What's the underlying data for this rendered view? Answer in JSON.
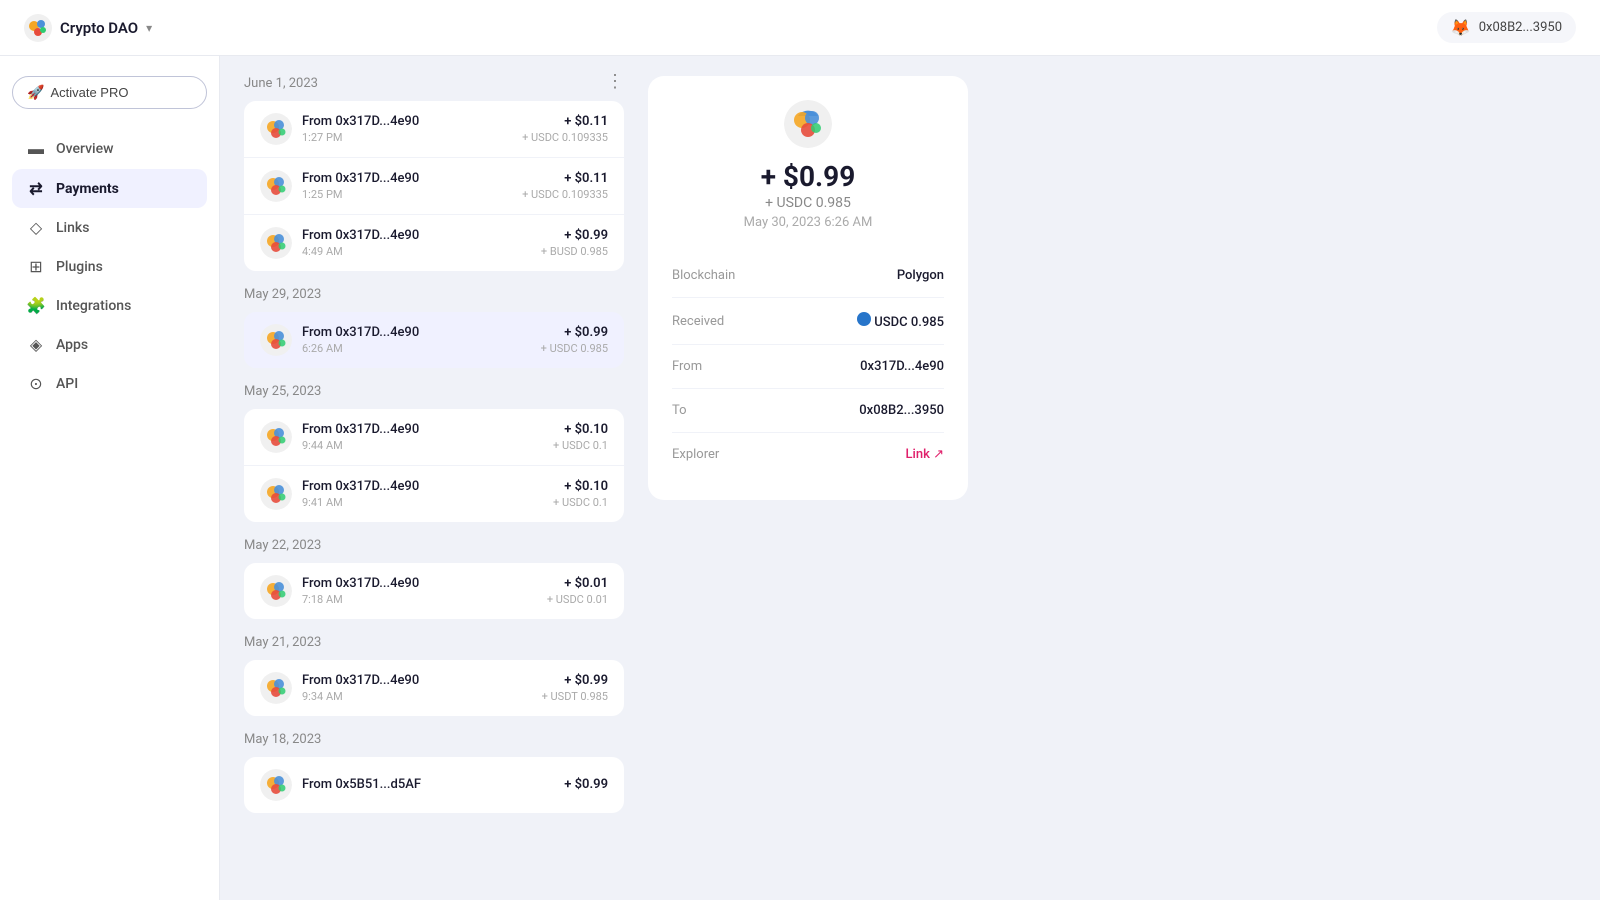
{
  "topbar": {
    "logo_emoji": "🟡",
    "title": "Crypto DAO",
    "chevron": "▾",
    "wallet_emoji": "🦊",
    "wallet_address": "0x08B2...3950"
  },
  "sidebar": {
    "activate_btn": "Activate PRO",
    "nav_items": [
      {
        "id": "overview",
        "label": "Overview",
        "icon": "▬",
        "active": false
      },
      {
        "id": "payments",
        "label": "Payments",
        "icon": "⇄",
        "active": true
      },
      {
        "id": "links",
        "label": "Links",
        "icon": "◇",
        "active": false
      },
      {
        "id": "plugins",
        "label": "Plugins",
        "icon": "⊞",
        "active": false
      },
      {
        "id": "integrations",
        "label": "Integrations",
        "icon": "🧩",
        "active": false
      },
      {
        "id": "apps",
        "label": "Apps",
        "icon": "◈",
        "active": false
      },
      {
        "id": "api",
        "label": "API",
        "icon": "⊙",
        "active": false
      }
    ]
  },
  "payments": {
    "more_icon": "⋮",
    "groups": [
      {
        "date": "June 1, 2023",
        "items": [
          {
            "from": "From 0x317D...4e90",
            "time": "1:27 PM",
            "usd": "+ $0.11",
            "token": "+ USDC 0.109335",
            "selected": false
          },
          {
            "from": "From 0x317D...4e90",
            "time": "1:25 PM",
            "usd": "+ $0.11",
            "token": "+ USDC 0.109335",
            "selected": false
          },
          {
            "from": "From 0x317D...4e90",
            "time": "4:49 AM",
            "usd": "+ $0.99",
            "token": "+ BUSD 0.985",
            "selected": false
          }
        ]
      },
      {
        "date": "May 29, 2023",
        "items": [
          {
            "from": "From 0x317D...4e90",
            "time": "6:26 AM",
            "usd": "+ $0.99",
            "token": "+ USDC 0.985",
            "selected": true
          }
        ]
      },
      {
        "date": "May 25, 2023",
        "items": [
          {
            "from": "From 0x317D...4e90",
            "time": "9:44 AM",
            "usd": "+ $0.10",
            "token": "+ USDC 0.1",
            "selected": false
          },
          {
            "from": "From 0x317D...4e90",
            "time": "9:41 AM",
            "usd": "+ $0.10",
            "token": "+ USDC 0.1",
            "selected": false
          }
        ]
      },
      {
        "date": "May 22, 2023",
        "items": [
          {
            "from": "From 0x317D...4e90",
            "time": "7:18 AM",
            "usd": "+ $0.01",
            "token": "+ USDC 0.01",
            "selected": false
          }
        ]
      },
      {
        "date": "May 21, 2023",
        "items": [
          {
            "from": "From 0x317D...4e90",
            "time": "9:34 AM",
            "usd": "+ $0.99",
            "token": "+ USDT 0.985",
            "selected": false
          }
        ]
      },
      {
        "date": "May 18, 2023",
        "items": [
          {
            "from": "From 0x5B51...d5AF",
            "time": "",
            "usd": "+ $0.99",
            "token": "",
            "selected": false
          }
        ]
      }
    ]
  },
  "detail": {
    "amount": "+ $0.99",
    "token": "+ USDC 0.985",
    "date": "May 30, 2023 6:26 AM",
    "rows": [
      {
        "key": "Blockchain",
        "value": "Polygon",
        "type": "text"
      },
      {
        "key": "Received",
        "value": "USDC 0.985",
        "type": "usdc"
      },
      {
        "key": "From",
        "value": "0x317D...4e90",
        "type": "text"
      },
      {
        "key": "To",
        "value": "0x08B2...3950",
        "type": "text"
      },
      {
        "key": "Explorer",
        "value": "Link",
        "type": "link"
      }
    ]
  }
}
